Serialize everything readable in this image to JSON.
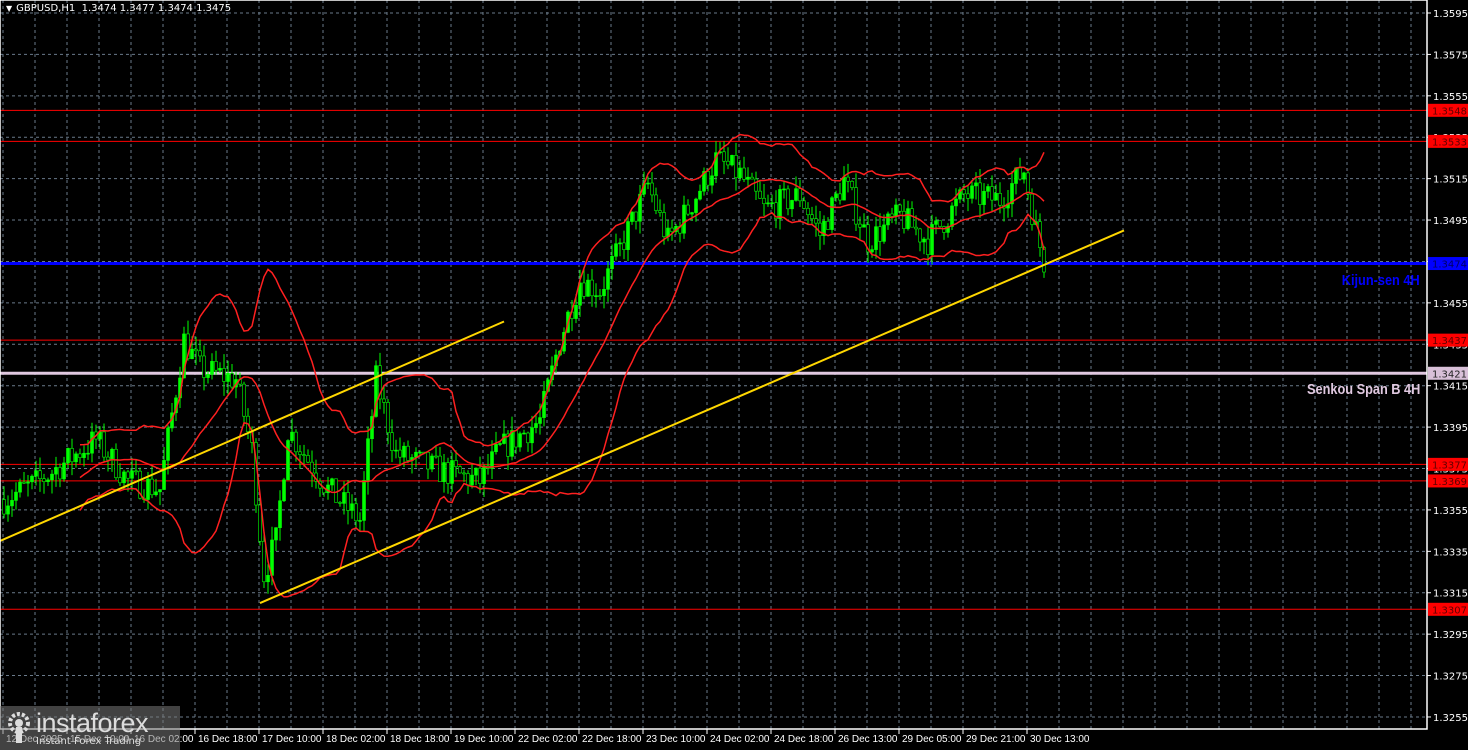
{
  "header": {
    "symbol": "GBPUSD,H1",
    "ohlc": "1.3474 1.3477 1.3474 1.3475"
  },
  "watermark": {
    "brand": "instaforex",
    "tagline": "Instant Forex Trading"
  },
  "colors": {
    "candle": "#00ff00",
    "bands": "#ff2020",
    "trend": "#ffd700",
    "support": "#ff0000",
    "kijun": "#0000ff",
    "senkou": "#e0c8e0",
    "grid": "#6a7a8a"
  },
  "chart_data": {
    "type": "candlestick",
    "title": "GBPUSD,H1",
    "ylim": [
      1.3255,
      1.3595
    ],
    "y_ticks": [
      "1.3595",
      "1.3575",
      "1.3555",
      "1.3535",
      "1.3515",
      "1.3495",
      "1.3475",
      "1.3455",
      "1.3435",
      "1.3415",
      "1.3395",
      "1.3375",
      "1.3355",
      "1.3335",
      "1.3315",
      "1.3295",
      "1.3275",
      "1.3255"
    ],
    "x_ticks": [
      "12 Dec 2025",
      "15 Dec 10:00",
      "16 Dec 02:00",
      "16 Dec 18:00",
      "17 Dec 10:00",
      "18 Dec 02:00",
      "18 Dec 18:00",
      "19 Dec 10:00",
      "22 Dec 02:00",
      "22 Dec 18:00",
      "23 Dec 10:00",
      "24 Dec 02:00",
      "24 Dec 18:00",
      "26 Dec 13:00",
      "29 Dec 05:00",
      "29 Dec 21:00",
      "30 Dec 13:00"
    ],
    "bars_per_x_tick": 16,
    "price_path_approx": [
      [
        0,
        1.336
      ],
      [
        9,
        1.3369
      ],
      [
        23,
        1.3389
      ],
      [
        31,
        1.3369
      ],
      [
        39,
        1.3365
      ],
      [
        45,
        1.3437
      ],
      [
        49,
        1.3423
      ],
      [
        58,
        1.3418
      ],
      [
        62,
        1.3384
      ],
      [
        65,
        1.3324
      ],
      [
        68,
        1.334
      ],
      [
        71,
        1.3394
      ],
      [
        81,
        1.3365
      ],
      [
        89,
        1.335
      ],
      [
        93,
        1.3418
      ],
      [
        98,
        1.3382
      ],
      [
        109,
        1.3374
      ],
      [
        119,
        1.3369
      ],
      [
        124,
        1.3384
      ],
      [
        134,
        1.3398
      ],
      [
        139,
        1.3437
      ],
      [
        144,
        1.3466
      ],
      [
        149,
        1.3461
      ],
      [
        154,
        1.3481
      ],
      [
        161,
        1.3512
      ],
      [
        166,
        1.3485
      ],
      [
        171,
        1.35
      ],
      [
        178,
        1.3524
      ],
      [
        184,
        1.3517
      ],
      [
        190,
        1.35
      ],
      [
        199,
        1.3507
      ],
      [
        204,
        1.3488
      ],
      [
        210,
        1.3514
      ],
      [
        216,
        1.3485
      ],
      [
        224,
        1.3497
      ],
      [
        231,
        1.3485
      ],
      [
        240,
        1.3507
      ],
      [
        249,
        1.3505
      ],
      [
        255,
        1.3519
      ],
      [
        258,
        1.349
      ],
      [
        260,
        1.3475
      ]
    ],
    "bollinger": {
      "period": 20,
      "deviations": 2
    },
    "levels": [
      {
        "price": 1.3548,
        "label": "1.3548",
        "kind": "support"
      },
      {
        "price": 1.3533,
        "label": "1.3533",
        "kind": "support"
      },
      {
        "price": 1.3474,
        "label": "1.3474",
        "kind": "kijun",
        "name": "Kijun-sen 4H"
      },
      {
        "price": 1.3437,
        "label": "1.3437",
        "kind": "support"
      },
      {
        "price": 1.3421,
        "label": "1.3421",
        "kind": "senkou",
        "name": "Senkou Span B 4H"
      },
      {
        "price": 1.3377,
        "label": "1.3377",
        "kind": "support"
      },
      {
        "price": 1.3369,
        "label": "1.3369",
        "kind": "support"
      },
      {
        "price": 1.3307,
        "label": "1.3307",
        "kind": "support"
      }
    ],
    "trendlines": [
      {
        "from": [
          -1,
          1.334
        ],
        "to": [
          125,
          1.3446
        ]
      },
      {
        "from": [
          64,
          1.331
        ],
        "to": [
          280,
          1.349
        ]
      }
    ]
  }
}
